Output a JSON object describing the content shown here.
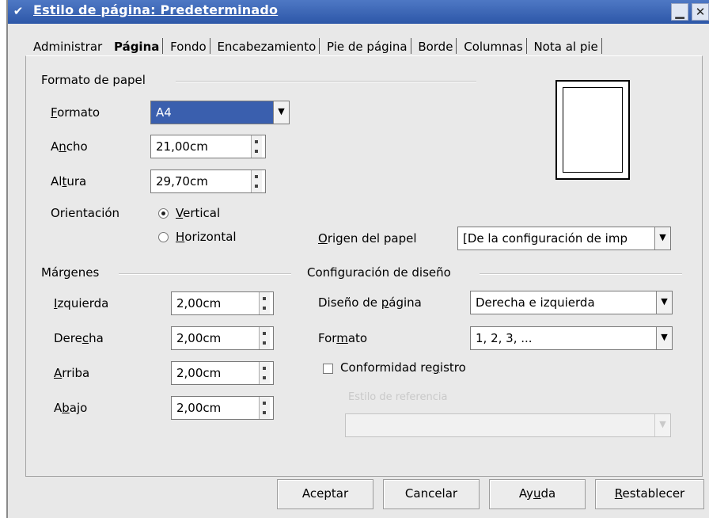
{
  "window": {
    "title": "Estilo de página: Predeterminado",
    "menu_glyph": "✔",
    "minimize_glyph": "▁",
    "close_glyph": "✕"
  },
  "tabs": [
    {
      "label": "Administrar"
    },
    {
      "label": "Página"
    },
    {
      "label": "Fondo"
    },
    {
      "label": "Encabezamiento"
    },
    {
      "label": "Pie de página"
    },
    {
      "label": "Borde"
    },
    {
      "label": "Columnas"
    },
    {
      "label": "Nota al pie"
    }
  ],
  "paper_format": {
    "group_title": "Formato de papel",
    "format_label_first": "F",
    "format_label_rest": "ormato",
    "format_value": "A4",
    "width_label_pre": "A",
    "width_label_u": "n",
    "width_label_post": "cho",
    "width_value": "21,00cm",
    "height_label_pre": "Al",
    "height_label_u": "t",
    "height_label_post": "ura",
    "height_value": "29,70cm",
    "orientation_label": "Orientación",
    "orientation_options": [
      {
        "pre": "",
        "u": "V",
        "post": "ertical",
        "selected": true
      },
      {
        "pre": "",
        "u": "H",
        "post": "orizontal",
        "selected": false
      }
    ],
    "paper_source_label_u": "O",
    "paper_source_label_rest": "rigen del papel",
    "paper_source_value": "[De la configuración de imp"
  },
  "margins": {
    "group_title": "Márgenes",
    "rows": [
      {
        "pre": "",
        "u": "I",
        "post": "zquierda",
        "value": "2,00cm"
      },
      {
        "pre": "Dere",
        "u": "c",
        "post": "ha",
        "value": "2,00cm"
      },
      {
        "pre": "",
        "u": "A",
        "post": "rriba",
        "value": "2,00cm"
      },
      {
        "pre": "A",
        "u": "b",
        "post": "ajo",
        "value": "2,00cm"
      }
    ]
  },
  "layout_settings": {
    "group_title": "Configuración de diseño",
    "page_layout_label_pre": "Diseño de ",
    "page_layout_label_u": "p",
    "page_layout_label_post": "ágina",
    "page_layout_value": "Derecha e izquierda",
    "format_label_pre": "For",
    "format_label_u": "m",
    "format_label_post": "ato",
    "format_value": "1, 2, 3, ...",
    "register_true_pre": "Conformidad re",
    "register_true_u": "g",
    "register_true_post": "istro",
    "register_true_checked": false,
    "reference_style_label": "Estilo de referencia",
    "reference_style_value": ""
  },
  "buttons": {
    "ok": "Aceptar",
    "cancel": "Cancelar",
    "help_pre": "Ay",
    "help_u": "u",
    "help_post": "da",
    "reset_u": "R",
    "reset_rest": "establecer"
  },
  "icons": {
    "dropdown": "▼"
  }
}
